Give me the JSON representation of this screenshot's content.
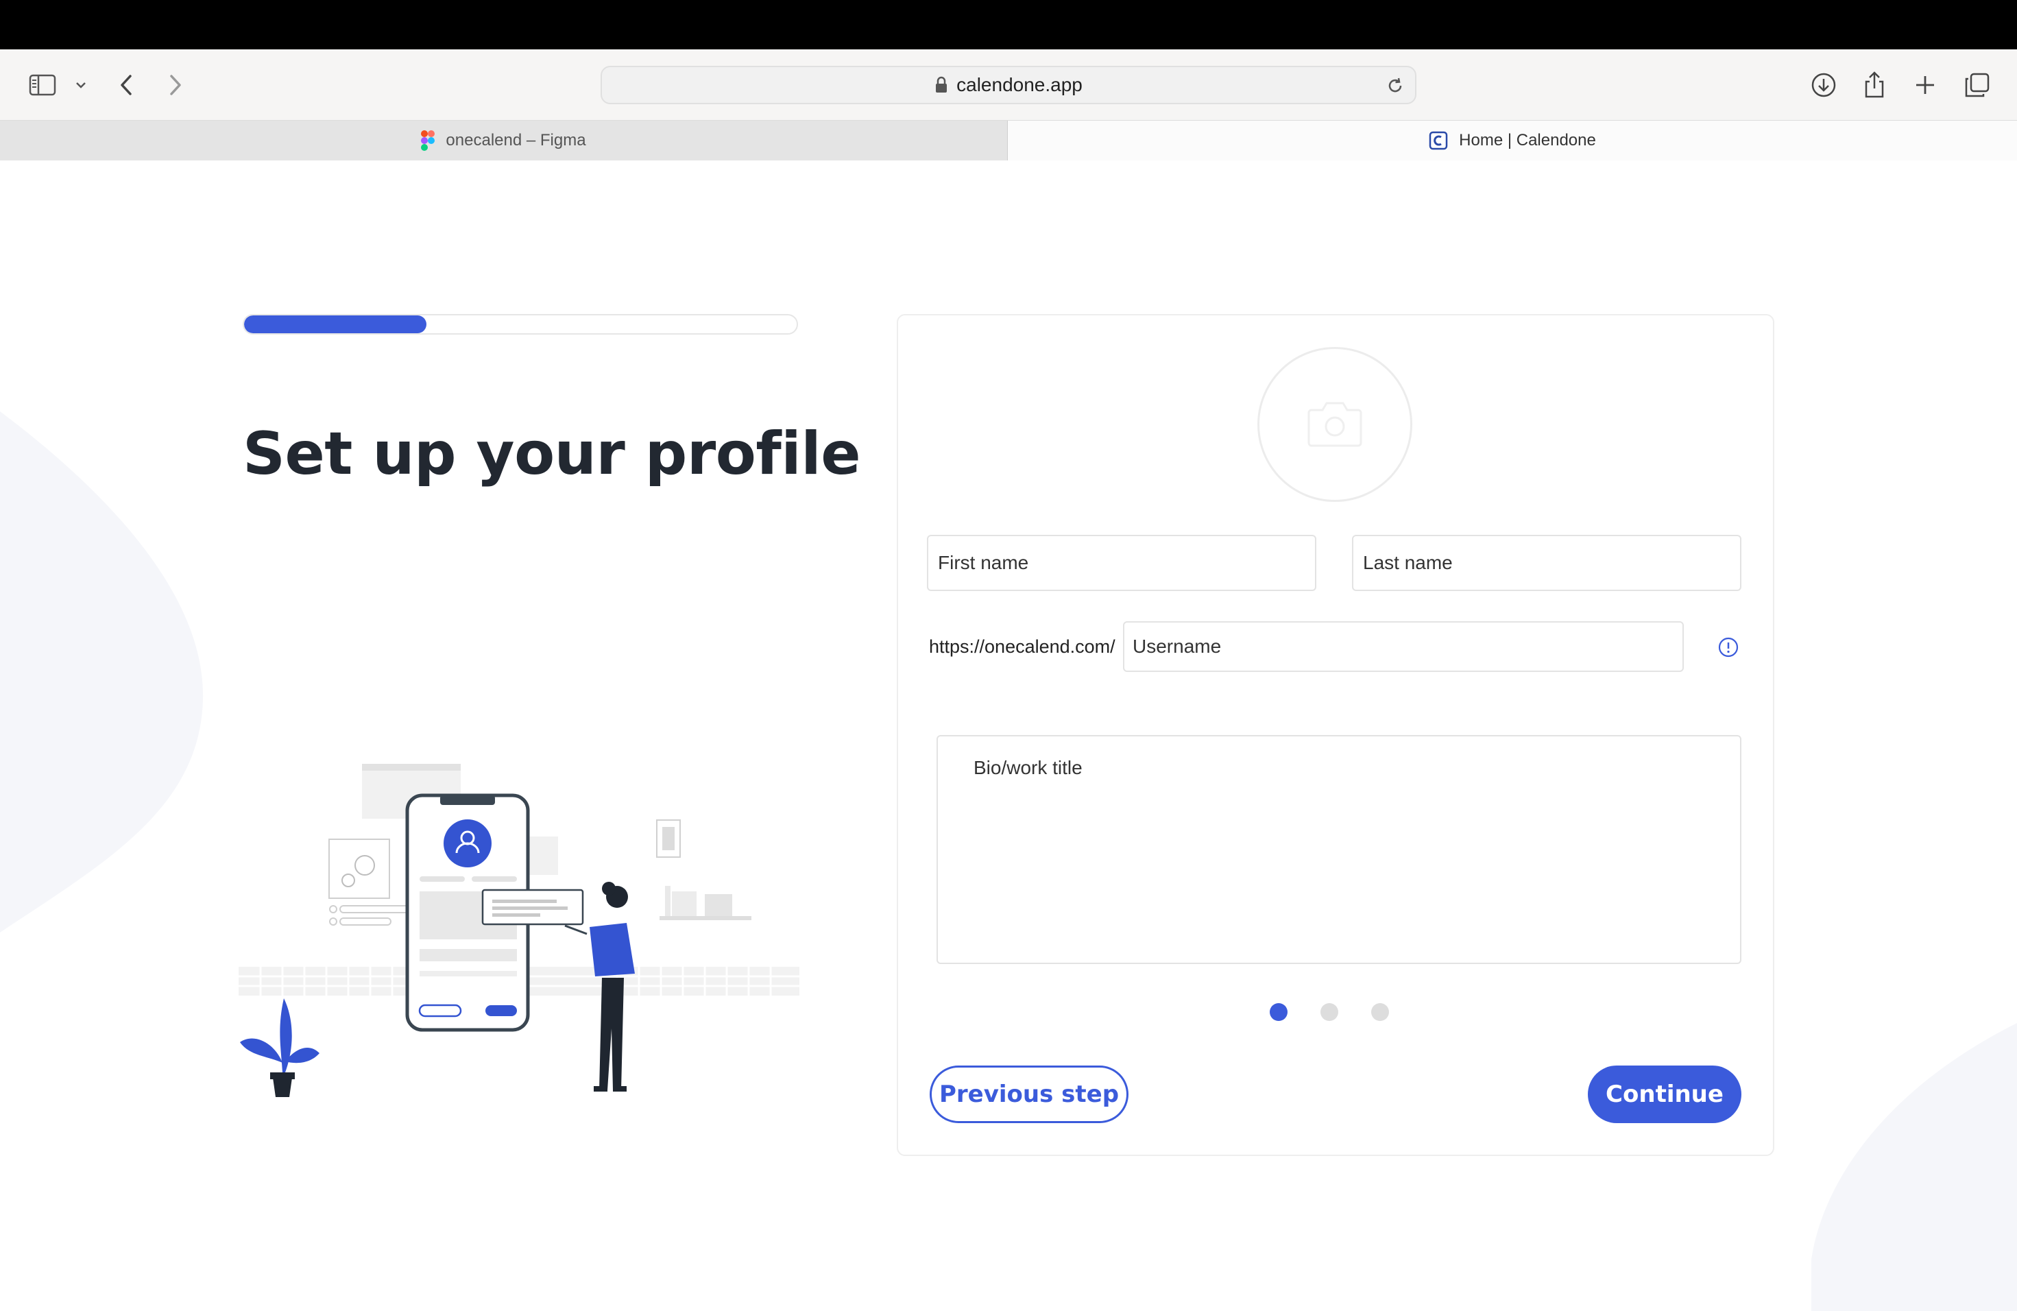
{
  "browser": {
    "url": "calendone.app",
    "tabs": [
      {
        "label": "onecalend – Figma",
        "favicon": "figma-icon",
        "active": false
      },
      {
        "label": "Home | Calendone",
        "favicon": "calendone-icon",
        "active": true
      }
    ],
    "icons": [
      "sidebar-icon",
      "chevron-down-icon",
      "back-icon",
      "forward-icon",
      "lock-icon",
      "reload-icon",
      "download-icon",
      "share-icon",
      "plus-icon",
      "tabs-overview-icon"
    ]
  },
  "onboarding": {
    "title": "Set up your profile",
    "progress_fraction": 0.33,
    "accent_color": "#3b5bdb"
  },
  "form": {
    "first_name_placeholder": "First name",
    "last_name_placeholder": "Last name",
    "url_prefix": "https://onecalend.com/",
    "username_placeholder": "Username",
    "bio_placeholder": "Bio/work title",
    "steps_total": 3,
    "step_current": 1,
    "previous_label": "Previous step",
    "continue_label": "Continue"
  }
}
